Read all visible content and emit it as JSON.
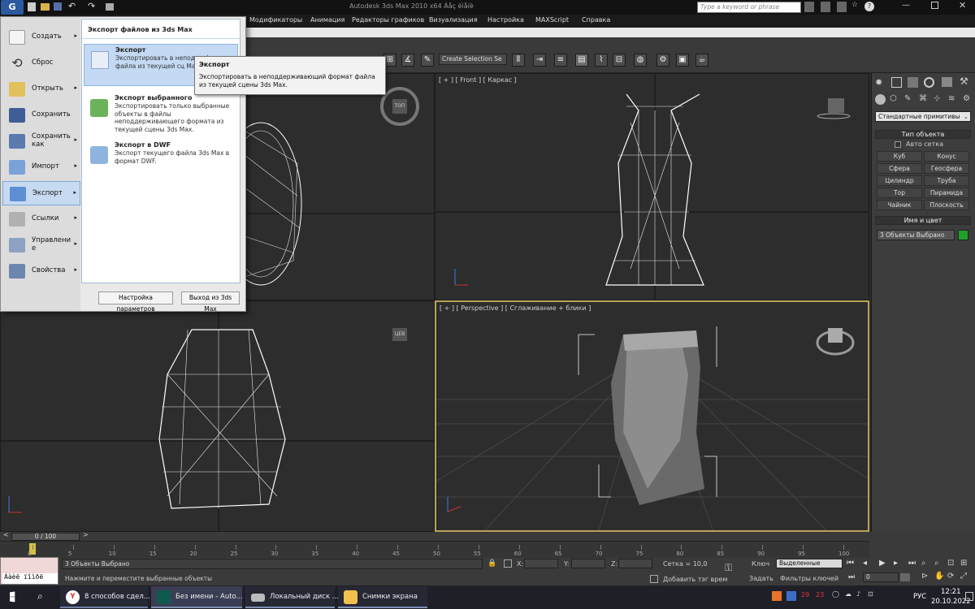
{
  "window": {
    "title": "Autodesk 3ds Max  2010 x64    Áåç èìåíè",
    "search_placeholder": "Type a keyword or phrase"
  },
  "menu": [
    "Модификаторы",
    "Анимация",
    "Редакторы графиков",
    "Визуализация",
    "Настройка",
    "MAXScript",
    "Справка"
  ],
  "toolbar": {
    "selection_set": "Create Selection Se"
  },
  "viewports": {
    "front": "[ + ] [ Front ] [ Каркас ]",
    "perspective": "[ + ] [ Perspective ] [ Сглаживание + блики ]",
    "cube_top": "ТОП",
    "cube_left": "ЦЕВ"
  },
  "app_menu": {
    "left_items": [
      {
        "label": "Создать",
        "arrow": true
      },
      {
        "label": "Сброс",
        "arrow": false
      },
      {
        "label": "Открыть",
        "arrow": true
      },
      {
        "label": "Сохранить",
        "arrow": false
      },
      {
        "label": "Сохранить как",
        "arrow": true
      },
      {
        "label": "Импорт",
        "arrow": true
      },
      {
        "label": "Экспорт",
        "arrow": true
      },
      {
        "label": "Ссылки",
        "arrow": true
      },
      {
        "label": "Управлени е",
        "arrow": true
      },
      {
        "label": "Свойства",
        "arrow": true
      }
    ],
    "submenu_title": "Экспорт файлов из 3ds Max",
    "submenu": [
      {
        "title": "Экспорт",
        "desc": "Экспортировать в неподде формат файла из текущей сц Max."
      },
      {
        "title": "Экспорт выбранного",
        "desc": "Экспортировать только выбранные объекты в файлы неподдерживающего формата из текущей сцены 3ds Max."
      },
      {
        "title": "Экспорт в DWF",
        "desc": "Экспорт текущего файла 3ds Max в формат DWF."
      }
    ],
    "settings_button": "Настройка параметров",
    "exit_button": "Выход из 3ds Max",
    "tooltip_title": "Экспорт",
    "tooltip_text": "Экспортировать в неподдерживающий формат файла из текущей сцены 3ds Max."
  },
  "command_panel": {
    "dropdown": "Стандартные примитивы",
    "object_type_header": "Тип объекта",
    "autogrid": "Авто сетка",
    "buttons": [
      "Куб",
      "Конус",
      "Сфера",
      "Геосфера",
      "Цилиндр",
      "Труба",
      "Тор",
      "Пирамида",
      "Чайник",
      "Плоскость"
    ],
    "name_color_header": "Имя и цвет",
    "name_field": "3 Объекты Выбрано"
  },
  "timeline": {
    "slider": "0 / 100",
    "ticks": [
      "0",
      "5",
      "10",
      "15",
      "20",
      "25",
      "30",
      "35",
      "40",
      "45",
      "50",
      "55",
      "60",
      "65",
      "70",
      "75",
      "80",
      "85",
      "90",
      "95",
      "100"
    ]
  },
  "status": {
    "selected": "3 Объекты Выбрано",
    "prompt": "Нажмите и переместите выбранные объекты",
    "maxscript": "Áàèë ïîìðë",
    "x_label": "X:",
    "y_label": "Y:",
    "z_label": "Z:",
    "grid": "Сетка = 10,0",
    "add_tag": "Добавить тэг врем",
    "key_label": "Ключ",
    "key_mode": "Выделенные",
    "set_key": "Задать",
    "key_filters": "Фильтры ключей",
    "frame": "0"
  },
  "taskbar": {
    "tasks": [
      "8 способов сдел...",
      "Без имени - Auto...",
      "Локальный диск ...",
      "Снимки экрана"
    ],
    "tray_nums": [
      "29",
      "23"
    ],
    "lang": "РУС",
    "time": "12:21",
    "date": "20.10.2022"
  }
}
